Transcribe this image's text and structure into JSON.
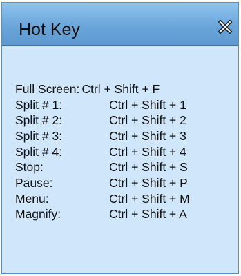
{
  "window": {
    "title": "Hot Key",
    "close_icon": "close-icon"
  },
  "hotkeys": [
    {
      "label": "Full Screen:",
      "keys": "Ctrl + Shift + F"
    },
    {
      "label": "Split # 1:",
      "keys": "Ctrl + Shift + 1"
    },
    {
      "label": "Split # 2:",
      "keys": "Ctrl + Shift + 2"
    },
    {
      "label": "Split # 3:",
      "keys": "Ctrl + Shift + 3"
    },
    {
      "label": "Split # 4:",
      "keys": "Ctrl + Shift + 4"
    },
    {
      "label": "Stop:",
      "keys": "Ctrl + Shift + S"
    },
    {
      "label": "Pause:",
      "keys": "Ctrl + Shift + P"
    },
    {
      "label": "Menu:",
      "keys": "Ctrl + Shift + M"
    },
    {
      "label": "Magnify:",
      "keys": "Ctrl + Shift + A"
    }
  ],
  "colors": {
    "titlebar": "#6ba6da",
    "body": "#cfe6fb",
    "border": "#5d8fbc"
  }
}
